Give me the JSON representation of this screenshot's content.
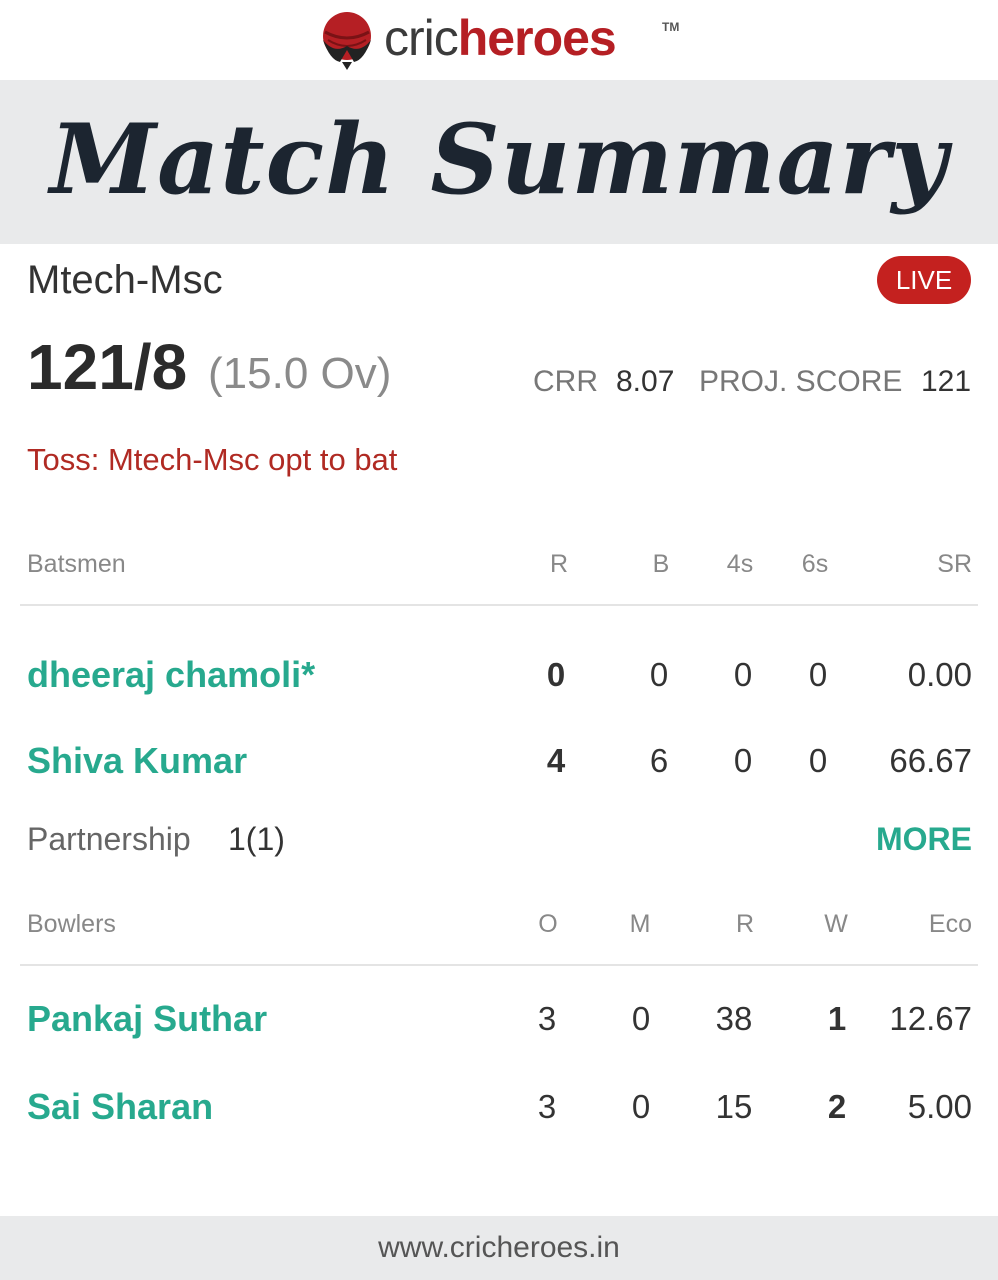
{
  "brand": {
    "logo_cric": "cric",
    "logo_heroes": "heroes",
    "trademark": "TM",
    "color_primary": "#b51f24",
    "color_accent": "#27a98e"
  },
  "banner": {
    "title": "Match Summary"
  },
  "match": {
    "team": "Mtech-Msc",
    "status_badge": "LIVE",
    "score": "121/8",
    "overs": "(15.0 Ov)",
    "crr_label": "CRR",
    "crr_value": "8.07",
    "proj_label": "PROJ. SCORE",
    "proj_value": "121",
    "toss": "Toss: Mtech-Msc opt to bat"
  },
  "batting": {
    "headers": [
      "Batsmen",
      "R",
      "B",
      "4s",
      "6s",
      "SR"
    ],
    "rows": [
      {
        "name": "dheeraj chamoli*",
        "r": "0",
        "b": "0",
        "fours": "0",
        "sixes": "0",
        "sr": "0.00"
      },
      {
        "name": "Shiva Kumar",
        "r": "4",
        "b": "6",
        "fours": "0",
        "sixes": "0",
        "sr": "66.67"
      }
    ],
    "partnership_label": "Partnership",
    "partnership_value": "1(1)",
    "more_label": "MORE"
  },
  "bowling": {
    "headers": [
      "Bowlers",
      "O",
      "M",
      "R",
      "W",
      "Eco"
    ],
    "rows": [
      {
        "name": "Pankaj Suthar",
        "o": "3",
        "m": "0",
        "r": "38",
        "w": "1",
        "eco": "12.67"
      },
      {
        "name": "Sai Sharan",
        "o": "3",
        "m": "0",
        "r": "15",
        "w": "2",
        "eco": "5.00"
      }
    ]
  },
  "footer": {
    "url": "www.cricheroes.in"
  }
}
